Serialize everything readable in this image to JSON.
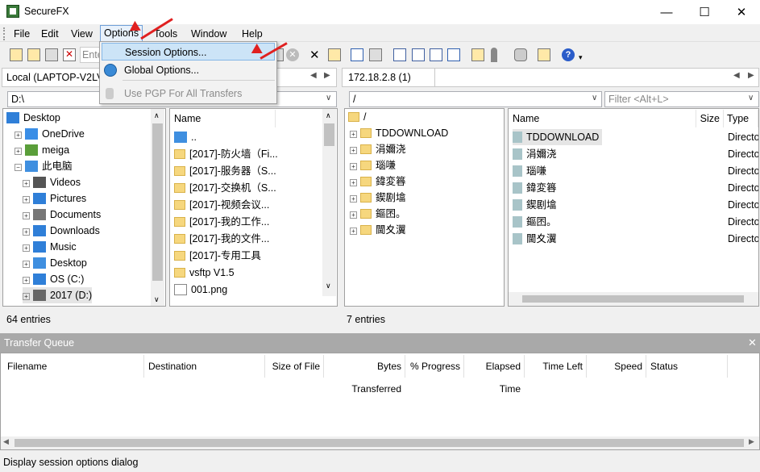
{
  "window": {
    "title": "SecureFX",
    "minimize": "—",
    "maximize": "☐",
    "close": "✕"
  },
  "menu": [
    "File",
    "Edit",
    "View",
    "Options",
    "Tools",
    "Window",
    "Help"
  ],
  "toolbar": {
    "session_placeholder": "Ente"
  },
  "options_menu": {
    "items": [
      {
        "label": "Session Options..."
      },
      {
        "label": "Global Options..."
      },
      {
        "label": "Use PGP For All Transfers"
      }
    ]
  },
  "left": {
    "tab": "Local (LAPTOP-V2LV",
    "path": "D:\\",
    "tree": [
      {
        "label": "Desktop"
      },
      {
        "label": "OneDrive"
      },
      {
        "label": "meiga"
      },
      {
        "label": "此电脑"
      },
      {
        "label": "Videos"
      },
      {
        "label": "Pictures"
      },
      {
        "label": "Documents"
      },
      {
        "label": "Downloads"
      },
      {
        "label": "Music"
      },
      {
        "label": "Desktop"
      },
      {
        "label": "OS (C:)"
      },
      {
        "label": "2017 (D:)"
      }
    ],
    "list_header": "Name",
    "list": [
      "..",
      "[2017]-防火墙（Fi...",
      "[2017]-服务器（S...",
      "[2017]-交换机（S...",
      "[2017]-视频会议...",
      "[2017]-我的工作...",
      "[2017]-我的文件...",
      "[2017]-专用工具",
      "vsftp V1.5",
      "001.png"
    ],
    "status": "64 entries"
  },
  "right": {
    "tab": "172.18.2.8 (1)",
    "path": "/",
    "filter_placeholder": "Filter <Alt+L>",
    "tree_root": "/",
    "tree": [
      "TDDOWNLOAD",
      "涓嬭浇",
      "瑙嗛",
      "鍏変簭",
      "鍥剧墖",
      "鏂囨。",
      "閫夊瀷"
    ],
    "headers": {
      "name": "Name",
      "size": "Size",
      "type": "Type"
    },
    "list": [
      {
        "name": "TDDOWNLOAD",
        "type": "Directo"
      },
      {
        "name": "涓嬭浇",
        "type": "Directo"
      },
      {
        "name": "瑙嗛",
        "type": "Directo"
      },
      {
        "name": "鍏変簭",
        "type": "Directo"
      },
      {
        "name": "鍥剧墖",
        "type": "Directo"
      },
      {
        "name": "鏂囨。",
        "type": "Directo"
      },
      {
        "name": "閫夊瀷",
        "type": "Directo"
      }
    ],
    "status": "7 entries"
  },
  "queue": {
    "title": "Transfer Queue",
    "close": "✕",
    "columns": [
      "Filename",
      "Destination",
      "Size of File",
      "Bytes Transferred",
      "% Progress",
      "Elapsed Time",
      "Time Left",
      "Speed",
      "Status"
    ]
  },
  "statusbar": "Display session options dialog"
}
